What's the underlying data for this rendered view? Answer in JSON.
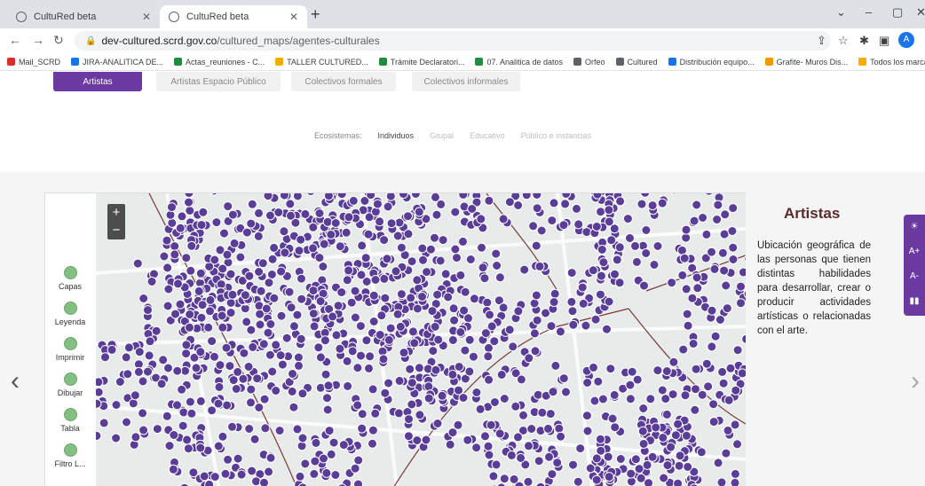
{
  "browser": {
    "tabs": [
      {
        "title": "CultuRed beta",
        "active": false
      },
      {
        "title": "CultuRed beta",
        "active": true
      }
    ],
    "new_tab": "+",
    "url_domain": "dev-cultured.scrd.gov.co",
    "url_path": "/cultured_maps/agentes-culturales",
    "avatar_letter": "A",
    "bookmarks": [
      {
        "label": "Mail_SCRD",
        "color": "#d93025"
      },
      {
        "label": "JIRA-ANALITICA DE...",
        "color": "#1a73e8"
      },
      {
        "label": "Actas_reuniones - C...",
        "color": "#1e8e3e"
      },
      {
        "label": "TALLER CULTURED...",
        "color": "#f9ab00"
      },
      {
        "label": "Trámite Declaratori...",
        "color": "#1e8e3e"
      },
      {
        "label": "07. Analitica de datos",
        "color": "#1e8e3e"
      },
      {
        "label": "Orfeo",
        "color": "#5f6368"
      },
      {
        "label": "Cultured",
        "color": "#5f6368"
      },
      {
        "label": "Distribución equipo...",
        "color": "#1a73e8"
      },
      {
        "label": "Grafite- Muros Dis...",
        "color": "#f29900"
      },
      {
        "label": "Todos los marcadores",
        "color": "#f9ab00"
      }
    ]
  },
  "page": {
    "category_tabs": [
      {
        "label": "Artistas",
        "active": true
      },
      {
        "label": "Artistas Espacio Público",
        "active": false
      },
      {
        "label": "Colectivos formales",
        "active": false
      },
      {
        "label": "Colectivos informales",
        "active": false
      }
    ],
    "ecosystems": {
      "label": "Ecosistemas:",
      "items": [
        {
          "label": "Individuos",
          "selected": true
        },
        {
          "label": "Grupal",
          "selected": false
        },
        {
          "label": "Educativo",
          "selected": false
        },
        {
          "label": "Público e instancias",
          "selected": false
        }
      ]
    },
    "map": {
      "zoom_in": "+",
      "zoom_out": "−",
      "marker_color": "#5a3d96",
      "tools": [
        {
          "label": "Capas",
          "icon": "layers-icon"
        },
        {
          "label": "Leyenda",
          "icon": "legend-icon"
        },
        {
          "label": "Imprimir",
          "icon": "print-icon"
        },
        {
          "label": "Dibujar",
          "icon": "draw-icon"
        },
        {
          "label": "Tabla",
          "icon": "table-icon"
        },
        {
          "label": "Filtro L...",
          "icon": "filter-icon"
        }
      ]
    },
    "info": {
      "title": "Artistas",
      "description": "Ubicación geográfica de las personas que tienen distintas habilidades para desarrollar, crear o producir actividades artísticas o relacionadas con el arte."
    },
    "carousel": {
      "prev": "‹",
      "next": "›"
    },
    "accessibility": [
      {
        "label": "☀",
        "icon": "contrast-icon"
      },
      {
        "label": "A+",
        "icon": "increase-font-icon"
      },
      {
        "label": "A-",
        "icon": "decrease-font-icon"
      },
      {
        "label": "▮▮",
        "icon": "sign-language-icon"
      }
    ]
  }
}
